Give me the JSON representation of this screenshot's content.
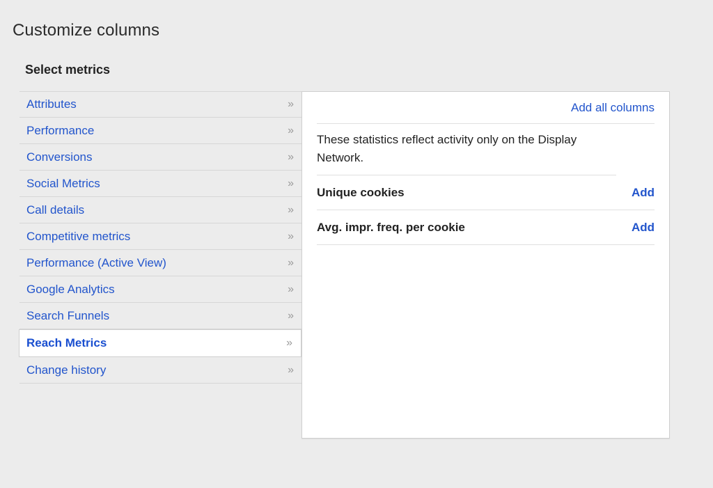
{
  "dialog": {
    "title": "Customize columns",
    "section_heading": "Select metrics"
  },
  "colors": {
    "link": "#2255cc",
    "background": "#ececec",
    "panel_background": "#ffffff",
    "divider": "#d6d6d6",
    "chevron": "#9a9a9a",
    "text": "#222222"
  },
  "categories": {
    "chevron_icon": "»",
    "items": [
      {
        "label": "Attributes",
        "selected": false
      },
      {
        "label": "Performance",
        "selected": false
      },
      {
        "label": "Conversions",
        "selected": false
      },
      {
        "label": "Social Metrics",
        "selected": false
      },
      {
        "label": "Call details",
        "selected": false
      },
      {
        "label": "Competitive metrics",
        "selected": false
      },
      {
        "label": "Performance (Active View)",
        "selected": false
      },
      {
        "label": "Google Analytics",
        "selected": false
      },
      {
        "label": "Search Funnels",
        "selected": false
      },
      {
        "label": "Reach Metrics",
        "selected": true
      },
      {
        "label": "Change history",
        "selected": false
      }
    ]
  },
  "metrics_panel": {
    "add_all_label": "Add all columns",
    "note": "These statistics reflect activity only on the Display Network.",
    "metrics": [
      {
        "name": "Unique cookies",
        "add_label": "Add"
      },
      {
        "name": "Avg. impr. freq. per cookie",
        "add_label": "Add"
      }
    ]
  }
}
